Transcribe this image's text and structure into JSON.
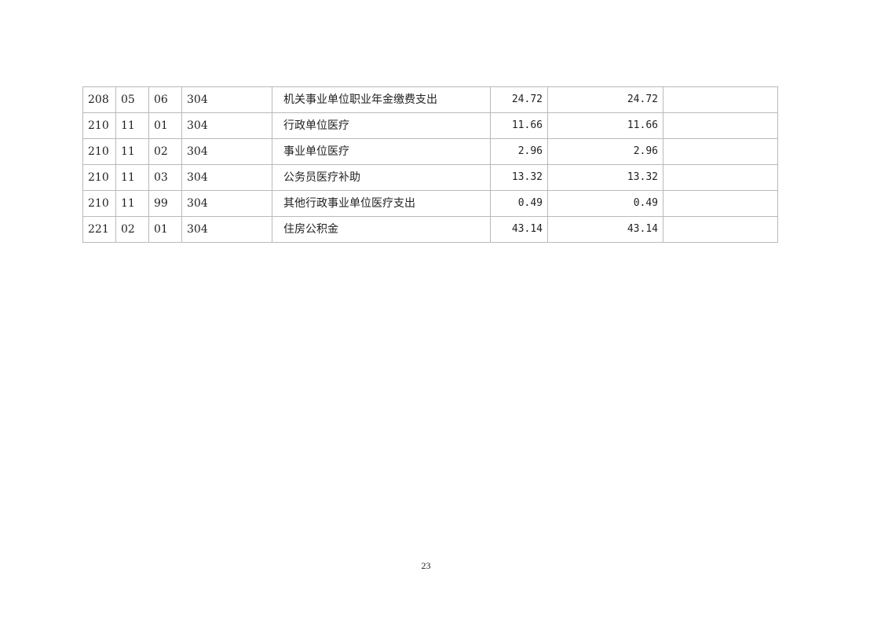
{
  "table": {
    "rows": [
      {
        "class": "208",
        "item": "05",
        "subitem": "06",
        "econ": "304",
        "name": "机关事业单位职业年金缴费支出",
        "amount": "24.72",
        "basic": "24.72",
        "project": ""
      },
      {
        "class": "210",
        "item": "11",
        "subitem": "01",
        "econ": "304",
        "name": "行政单位医疗",
        "amount": "11.66",
        "basic": "11.66",
        "project": ""
      },
      {
        "class": "210",
        "item": "11",
        "subitem": "02",
        "econ": "304",
        "name": "事业单位医疗",
        "amount": "2.96",
        "basic": "2.96",
        "project": ""
      },
      {
        "class": "210",
        "item": "11",
        "subitem": "03",
        "econ": "304",
        "name": "公务员医疗补助",
        "amount": "13.32",
        "basic": "13.32",
        "project": ""
      },
      {
        "class": "210",
        "item": "11",
        "subitem": "99",
        "econ": "304",
        "name": "其他行政事业单位医疗支出",
        "amount": "0.49",
        "basic": "0.49",
        "project": ""
      },
      {
        "class": "221",
        "item": "02",
        "subitem": "01",
        "econ": "304",
        "name": "住房公积金",
        "amount": "43.14",
        "basic": "43.14",
        "project": ""
      }
    ]
  },
  "page": {
    "number": "23"
  }
}
